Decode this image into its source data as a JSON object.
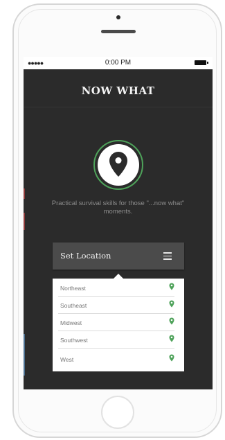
{
  "status_bar": {
    "signal": "●●●●●",
    "time": "0:00 PM"
  },
  "app": {
    "title": "NOW WHAT",
    "tagline": "Practical survival skills for those \"...now what\" moments."
  },
  "location_picker": {
    "label": "Set Location",
    "menu_icon": "hamburger-menu-icon",
    "regions": [
      {
        "label": "Northeast",
        "icon": "map-pin-icon"
      },
      {
        "label": "Southeast",
        "icon": "map-pin-icon"
      },
      {
        "label": "Midwest",
        "icon": "map-pin-icon"
      },
      {
        "label": "Southwest",
        "icon": "map-pin-icon"
      },
      {
        "label": "West",
        "icon": "map-pin-icon"
      }
    ]
  },
  "colors": {
    "background": "#2b2b2b",
    "accent_green": "#4ea25a",
    "bar": "#4b4b4b"
  }
}
